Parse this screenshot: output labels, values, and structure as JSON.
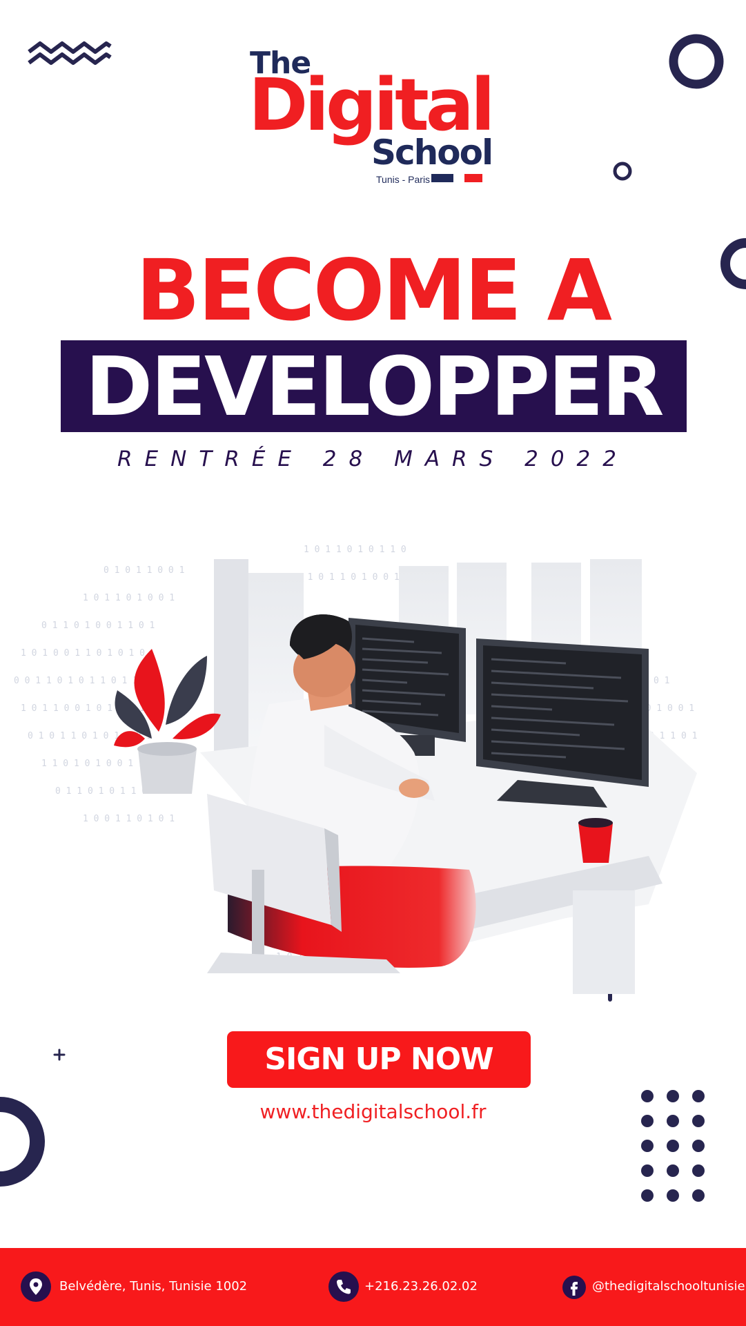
{
  "logo": {
    "the": "The",
    "digital": "Digital",
    "school": "School",
    "locations": "Tunis - Paris"
  },
  "headline": {
    "line1": "BECOME A",
    "line2": "DEVELOPPER"
  },
  "date": "RENTRÉE 28 MARS 2022",
  "cta": {
    "signup_label": "SIGN UP NOW",
    "website": "www.thedigitalschool.fr"
  },
  "footer": {
    "address": "Belvédère, Tunis, Tunisie 1002",
    "phone": "+216.23.26.02.02",
    "social": "@thedigitalschooltunisie"
  },
  "colors": {
    "brand_red": "#f01f22",
    "brand_navy": "#1f2a5a",
    "banner_purple": "#27104e"
  },
  "icons": [
    "location-pin-icon",
    "phone-icon",
    "facebook-icon"
  ]
}
